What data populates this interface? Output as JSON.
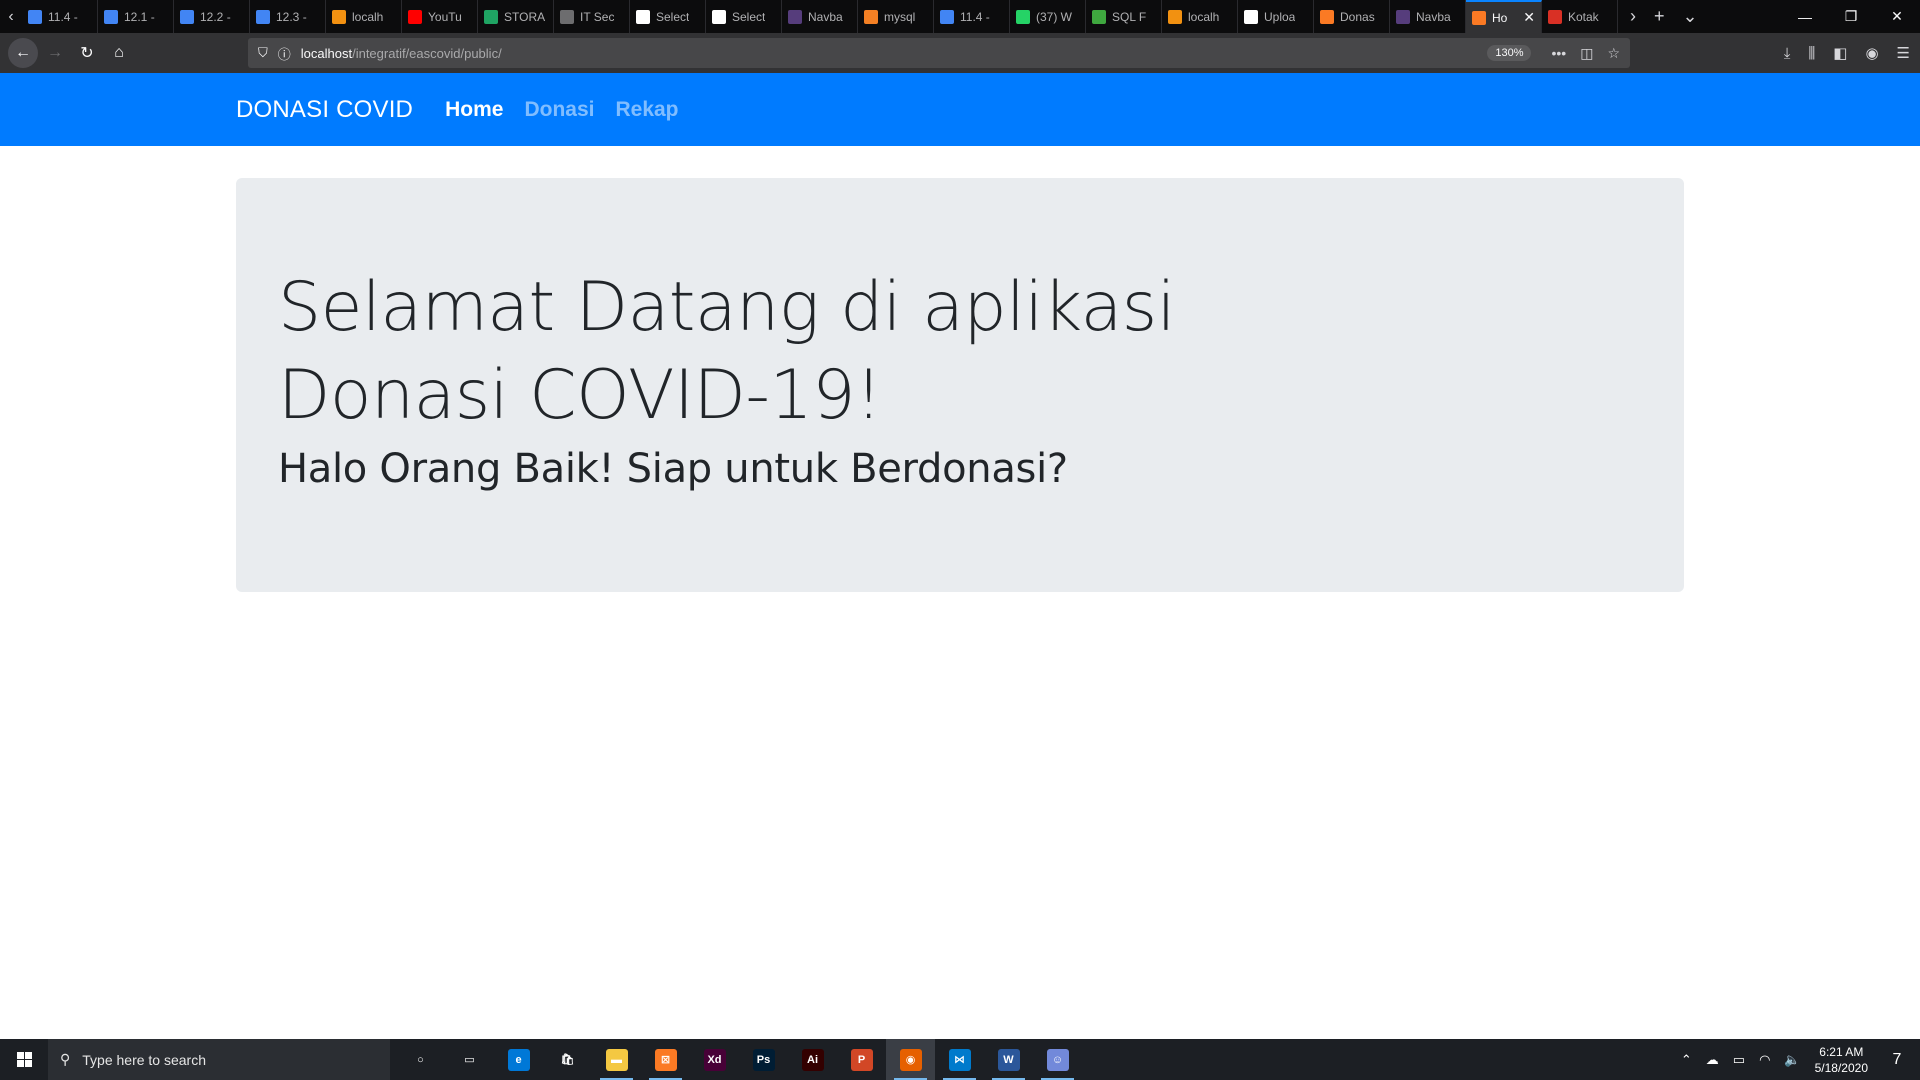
{
  "browser": {
    "tabs": [
      {
        "title": "11.4 -",
        "icon": "docs-icon",
        "color": "#4285f4"
      },
      {
        "title": "12.1 -",
        "icon": "docs-icon",
        "color": "#4285f4"
      },
      {
        "title": "12.2 -",
        "icon": "docs-icon",
        "color": "#4285f4"
      },
      {
        "title": "12.3 -",
        "icon": "docs-icon",
        "color": "#4285f4"
      },
      {
        "title": "localh",
        "icon": "phpmyadmin-icon",
        "color": "#f29111"
      },
      {
        "title": "YouTu",
        "icon": "youtube-icon",
        "color": "#ff0000"
      },
      {
        "title": "STORA",
        "icon": "drive-icon",
        "color": "#1fa463"
      },
      {
        "title": "IT Sec",
        "icon": "shield-icon",
        "color": "#6d6d6f"
      },
      {
        "title": "Select",
        "icon": "select-icon",
        "color": "#ffffff"
      },
      {
        "title": "Select",
        "icon": "select-icon",
        "color": "#ffffff"
      },
      {
        "title": "Navba",
        "icon": "bootstrap-icon",
        "color": "#563d7c"
      },
      {
        "title": "mysql",
        "icon": "mysql-icon",
        "color": "#f48024"
      },
      {
        "title": "11.4 -",
        "icon": "docs-icon",
        "color": "#4285f4"
      },
      {
        "title": "(37) W",
        "icon": "whatsapp-icon",
        "color": "#25d366"
      },
      {
        "title": "SQL F",
        "icon": "sql-icon",
        "color": "#3fa83f"
      },
      {
        "title": "localh",
        "icon": "phpmyadmin-icon",
        "color": "#f29111"
      },
      {
        "title": "Uploa",
        "icon": "github-icon",
        "color": "#ffffff"
      },
      {
        "title": "Donas",
        "icon": "xampp-icon",
        "color": "#fb7a24"
      },
      {
        "title": "Navba",
        "icon": "bootstrap-icon",
        "color": "#563d7c"
      },
      {
        "title": "Ho",
        "icon": "xampp-icon",
        "color": "#fb7a24",
        "active": true
      },
      {
        "title": "Kotak",
        "icon": "gmail-icon",
        "color": "#d93025"
      }
    ],
    "url_host": "localhost",
    "url_path": "/integratif/eascovid/public/",
    "zoom": "130%"
  },
  "site": {
    "brand": "DONASI COVID",
    "nav": [
      {
        "label": "Home",
        "active": true
      },
      {
        "label": "Donasi",
        "active": false
      },
      {
        "label": "Rekap",
        "active": false
      }
    ],
    "title": "Selamat Datang di aplikasi Donasi COVID-19!",
    "lead": "Halo Orang Baik! Siap untuk Berdonasi?"
  },
  "taskbar": {
    "search_placeholder": "Type here to search",
    "apps": [
      {
        "name": "cortana-icon",
        "glyph": "○",
        "color": "transparent"
      },
      {
        "name": "task-view-icon",
        "glyph": "▭",
        "color": "transparent"
      },
      {
        "name": "edge-icon",
        "glyph": "e",
        "color": "#0078d7"
      },
      {
        "name": "store-icon",
        "glyph": "🛍",
        "color": "transparent"
      },
      {
        "name": "file-explorer-icon",
        "glyph": "▬",
        "color": "#f4c842",
        "running": true
      },
      {
        "name": "xampp-icon",
        "glyph": "⊠",
        "color": "#fb7a24",
        "running": true
      },
      {
        "name": "adobe-xd-icon",
        "glyph": "Xd",
        "color": "#470137"
      },
      {
        "name": "photoshop-icon",
        "glyph": "Ps",
        "color": "#001d34"
      },
      {
        "name": "illustrator-icon",
        "glyph": "Ai",
        "color": "#330000"
      },
      {
        "name": "powerpoint-icon",
        "glyph": "P",
        "color": "#d24726"
      },
      {
        "name": "firefox-icon",
        "glyph": "◉",
        "color": "#e66000",
        "running": true,
        "focused": true
      },
      {
        "name": "vscode-icon",
        "glyph": "⋈",
        "color": "#007acc",
        "running": true
      },
      {
        "name": "word-icon",
        "glyph": "W",
        "color": "#2b579a",
        "running": true
      },
      {
        "name": "discord-icon",
        "glyph": "☺",
        "color": "#7289da",
        "running": true
      }
    ],
    "time": "6:21 AM",
    "date": "5/18/2020",
    "notification_count": "7"
  }
}
